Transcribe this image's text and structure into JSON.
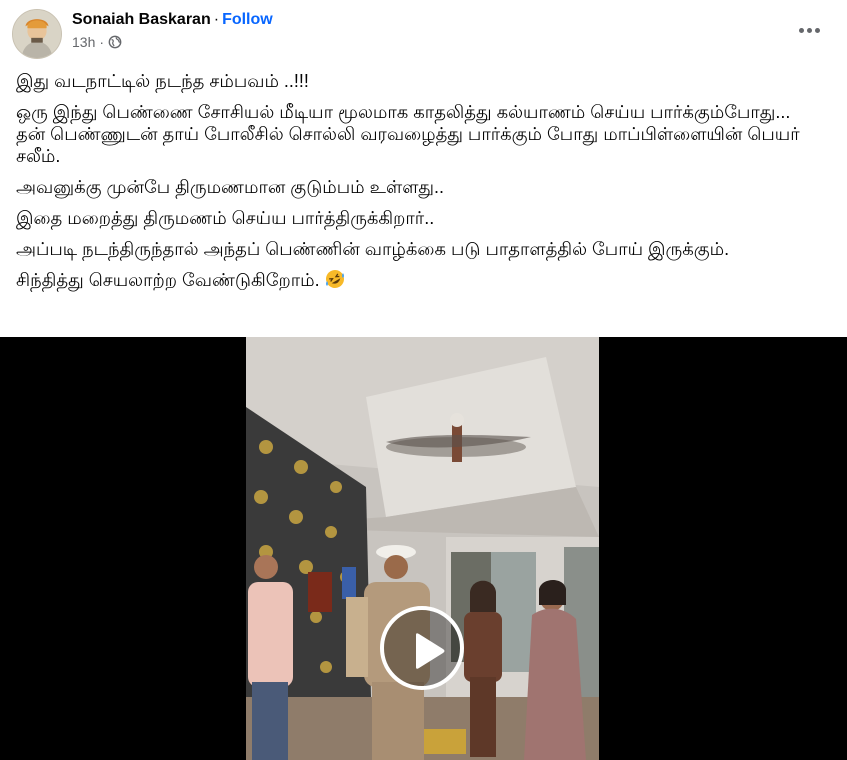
{
  "post": {
    "author": "Sonaiah Baskaran",
    "separator": "·",
    "follow_label": "Follow",
    "time": "13h",
    "meta_separator": "·",
    "audience_icon": "globe-icon",
    "menu_icon": "more-options-icon",
    "paragraphs": [
      "இது வடநாட்டில் நடந்த  சம்பவம் ..!!!",
      "ஒரு இந்து பெண்ணை சோசியல் மீடியா மூலமாக காதலித்து கல்யாணம் செய்ய பார்க்கும்போது... தன் பெண்ணுடன் தாய் போலீசில் சொல்லி வரவழைத்து பார்க்கும் போது மாப்பிள்ளையின் பெயர் சலீம்.",
      "அவனுக்கு முன்பே திருமணமான குடும்பம் உள்ளது..",
      "இதை மறைத்து திருமணம் செய்ய பார்த்திருக்கிறார்..",
      "அப்படி நடந்திருந்தால் அந்தப் பெண்ணின் வாழ்க்கை படு பாதாளத்தில் போய் இருக்கும்.",
      "சிந்தித்து செயலாற்ற வேண்டுகிறோம்."
    ],
    "last_paragraph_emoji": "rolling-on-floor-laughing-emoji",
    "video": {
      "play_icon": "play-icon",
      "background": "#000000"
    }
  },
  "colors": {
    "link_blue": "#0866ff",
    "secondary_text": "#65676b",
    "primary_text": "#050505"
  }
}
